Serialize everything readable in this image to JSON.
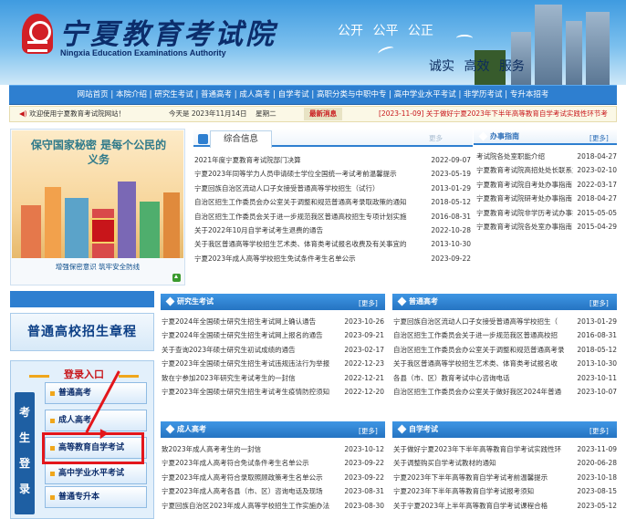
{
  "header": {
    "title": "宁夏教育考试院",
    "subtitle": "Ningxia Education Examinations Authority",
    "slogan_top": "公开  公平  公正",
    "slogan_bottom": "诚实  高效  服务"
  },
  "nav": {
    "items": [
      "网站首页",
      "本院介绍",
      "研究生考试",
      "普通高考",
      "成人高考",
      "自学考试",
      "高职分类与中职中专",
      "高中学业水平考试",
      "非学历考试",
      "专升本招考"
    ]
  },
  "infobar": {
    "welcome": "欢迎使用宁夏教育考试院网站！",
    "date": "今天是 2023年11月14日",
    "weekday": "星期二",
    "latest_label": "最新消息",
    "ticker": "[2023-11-09]  关于做好宁夏2023年下半年高等教育自学考试实践性环节考"
  },
  "poster": {
    "heading": "保守国家秘密 是每个公民的义务",
    "caption": "增强保密意识 筑牢安全防线"
  },
  "news": {
    "tab": "综合信息",
    "more": "更多",
    "items": [
      {
        "title": "2021年度宁夏教育考试院部门决算",
        "date": "2022-09-07"
      },
      {
        "title": "宁夏2023年同等学力人员申请硕士学位全国统一考试考前温馨提示",
        "date": "2023-05-19"
      },
      {
        "title": "宁夏回族自治区流动人口子女接受普通高等学校招生（试行）",
        "date": "2013-01-29"
      },
      {
        "title": "自治区招生工作委员会办公室关于调整和规范普通高考录取政策的通知",
        "date": "2018-05-12"
      },
      {
        "title": "自治区招生工作委员会关于进一步规范我区普通高校招生专项计划实施",
        "date": "2016-08-31"
      },
      {
        "title": "关于2022年10月自学考试考生退费的通告",
        "date": "2022-10-28"
      },
      {
        "title": "关于我区普通高等学校招生艺术类、体育类考试报名收费及有关事宜的",
        "date": "2013-10-30"
      },
      {
        "title": "宁夏2023年成人高等学校招生免试条件考生名单公示",
        "date": "2023-09-22"
      }
    ]
  },
  "guide": {
    "tab": "办事指南",
    "more": "[更多]",
    "items": [
      {
        "title": "考试院各处室职能介绍",
        "date": "2018-04-27"
      },
      {
        "title": "宁夏教育考试院高招处处长联系方式",
        "date": "2023-02-10"
      },
      {
        "title": "宁夏教育考试院自考处办事指南",
        "date": "2022-03-17"
      },
      {
        "title": "宁夏教育考试院研考处办事指南",
        "date": "2018-04-27"
      },
      {
        "title": "宁夏教育考试院非学历考试办事指南",
        "date": "2015-05-05"
      },
      {
        "title": "宁夏教育考试院各处室办事指南",
        "date": "2015-04-29"
      }
    ]
  },
  "chapter": "普通高校招生章程",
  "login": {
    "title": "登录入口",
    "vertical": [
      "考",
      "生",
      "登",
      "录"
    ],
    "buttons": [
      "普通高考",
      "成人高考",
      "高等教育自学考试",
      "高中学业水平考试",
      "普通专升本"
    ]
  },
  "grad": {
    "tab": "研究生考试",
    "more": "[更多]",
    "items": [
      {
        "title": "宁夏2024年全国硕士研究生招生考试网上确认通告",
        "date": "2023-10-26"
      },
      {
        "title": "宁夏2024年全国硕士研究生招生考试网上报名的通告",
        "date": "2023-09-21"
      },
      {
        "title": "关于查询2023年硕士研究生初试成绩的通告",
        "date": "2023-02-17"
      },
      {
        "title": "宁夏2023年全国硕士研究生招生考试违规违法行为举报",
        "date": "2022-12-23"
      },
      {
        "title": "致在宁参加2023年研究生考试考生的一封信",
        "date": "2022-12-21"
      },
      {
        "title": "宁夏2023年全国硕士研究生招生考试考生疫情防控须知",
        "date": "2022-12-20"
      }
    ]
  },
  "gaokao": {
    "tab": "普通高考",
    "more": "[更多]",
    "items": [
      {
        "title": "宁夏回族自治区流动人口子女接受普通高等学校招生（",
        "date": "2013-01-29"
      },
      {
        "title": "自治区招生工作委员会关于进一步规范我区普通高校招",
        "date": "2016-08-31"
      },
      {
        "title": "自治区招生工作委员会办公室关于调整和规范普通高考录",
        "date": "2018-05-12"
      },
      {
        "title": "关于我区普通高等学校招生艺术类、体育类考试报名收",
        "date": "2013-10-30"
      },
      {
        "title": "各县（市、区）教育考试中心咨询电话",
        "date": "2023-10-11"
      },
      {
        "title": "自治区招生工作委员会办公室关于做好我区2024年普通",
        "date": "2023-10-07"
      }
    ]
  },
  "adult": {
    "tab": "成人高考",
    "more": "[更多]",
    "items": [
      {
        "title": "致2023年成人高考考生的一封信",
        "date": "2023-10-12"
      },
      {
        "title": "宁夏2023年成人高考符合免试条件考生名单公示",
        "date": "2023-09-22"
      },
      {
        "title": "宁夏2023年成人高考符合录取照顾政策考生名单公示",
        "date": "2023-09-22"
      },
      {
        "title": "宁夏2023年成人高考各县（市、区）咨询电话及现场",
        "date": "2023-08-31"
      },
      {
        "title": "宁夏回族自治区2023年成人高等学校招生工作实施办法",
        "date": "2023-08-30"
      }
    ]
  },
  "selfstudy": {
    "tab": "自学考试",
    "more": "[更多]",
    "items": [
      {
        "title": "关于做好宁夏2023年下半年高等教育自学考试实践性环",
        "date": "2023-11-09"
      },
      {
        "title": "关于调整购买自学考试教材的通知",
        "date": "2020-06-28"
      },
      {
        "title": "宁夏2023年下半年高等教育自学考试考前温馨提示",
        "date": "2023-10-18"
      },
      {
        "title": "宁夏2023年下半年高等教育自学考试报考须知",
        "date": "2023-08-15"
      },
      {
        "title": "关于宁夏2023年上半年高等教育自学考试课程合格",
        "date": "2023-05-12"
      }
    ]
  },
  "colors": {
    "nav_blue": "#2e7fd0",
    "header_navy": "#0c2d6b",
    "highlight_red": "#e3161b"
  }
}
